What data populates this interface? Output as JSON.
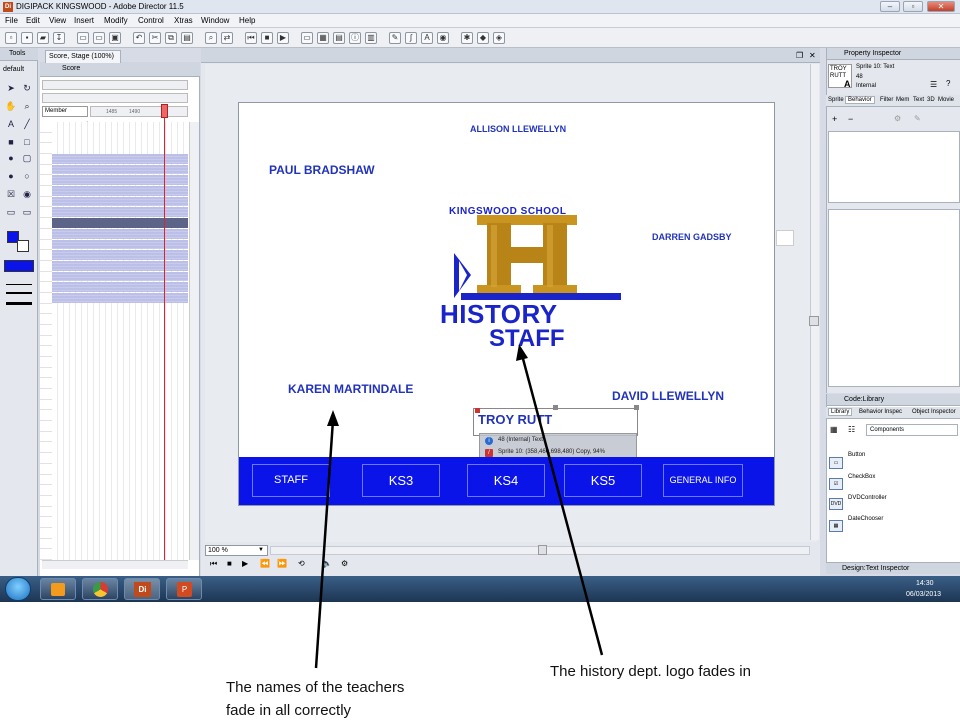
{
  "app": {
    "title": "DIGIPACK KINGSWOOD - Adobe Director 11.5",
    "icon": "Di"
  },
  "window_controls": {
    "minimize": "–",
    "restore": "▫",
    "close": "✕"
  },
  "menu": [
    "File",
    "Edit",
    "View",
    "Insert",
    "Modify",
    "Control",
    "Xtras",
    "Window",
    "Help"
  ],
  "tools_panel": {
    "title": "Tools",
    "preset": "default"
  },
  "score_panel": {
    "title": "Score",
    "channel_selector": "Member",
    "frame_labels": [
      "1485",
      "1490"
    ],
    "rows": [
      "1",
      "2",
      "3",
      "4",
      "5",
      "6",
      "7",
      "8",
      "9",
      "10",
      "11",
      "12",
      "13",
      "14",
      "15",
      "16",
      "17",
      "18",
      "19",
      "20",
      "21",
      "22",
      "23",
      "24",
      "25",
      "26",
      "27",
      "28",
      "29",
      "30",
      "31",
      "32",
      "33",
      "34",
      "35",
      "36",
      "37",
      "38",
      "39",
      "40",
      "41"
    ]
  },
  "stage_window": {
    "tab": "Score, Stage (100%)",
    "zoom": "100 %"
  },
  "stage": {
    "teachers": {
      "allison": "ALLISON LLEWELLYN",
      "paul": "PAUL BRADSHAW",
      "darren": "DARREN GADSBY",
      "karen": "KAREN MARTINDALE",
      "david": "DAVID LLEWELLYN",
      "troy": "TROY RUTT"
    },
    "logo": {
      "school": "KINGSWOOD SCHOOL",
      "letter": "H",
      "word": "HISTORY",
      "subtitle": "STAFF"
    },
    "nav": [
      "STAFF",
      "KS3",
      "KS4",
      "KS5",
      "GENERAL INFO"
    ],
    "tooltip": {
      "line1": "48 (Internal) Text",
      "line2": "Sprite 10: (358,460,698,480) Copy, 94%",
      "line3": ""
    }
  },
  "property_inspector": {
    "title": "Property Inspector",
    "sprite_name": "TROY RUTT",
    "sprite_line1": "Sprite 10: Text",
    "sprite_line2": "48",
    "sprite_line3": "Internal",
    "tabs": [
      "Sprite",
      "Behavior",
      "Filter",
      "Mem",
      "Text",
      "3D",
      "Movie"
    ]
  },
  "code_library": {
    "title": "Code:Library",
    "tabs": [
      "Library",
      "Behavior Inspec",
      "Object Inspector"
    ],
    "category": "Components",
    "items": [
      "Button",
      "CheckBox",
      "DVDController",
      "DateChooser"
    ]
  },
  "design_panel": {
    "title": "Design:Text Inspector"
  },
  "taskbar": {
    "time": "14:30",
    "date": "06/03/2013"
  },
  "annotations": {
    "left_line1": "The names of the teachers",
    "left_line2": "fade in all correctly",
    "right": "The history dept. logo fades in"
  },
  "colors": {
    "stage_text": "#2233bb",
    "nav_bar": "#0a14e8",
    "logo_gold": "#b88418"
  }
}
